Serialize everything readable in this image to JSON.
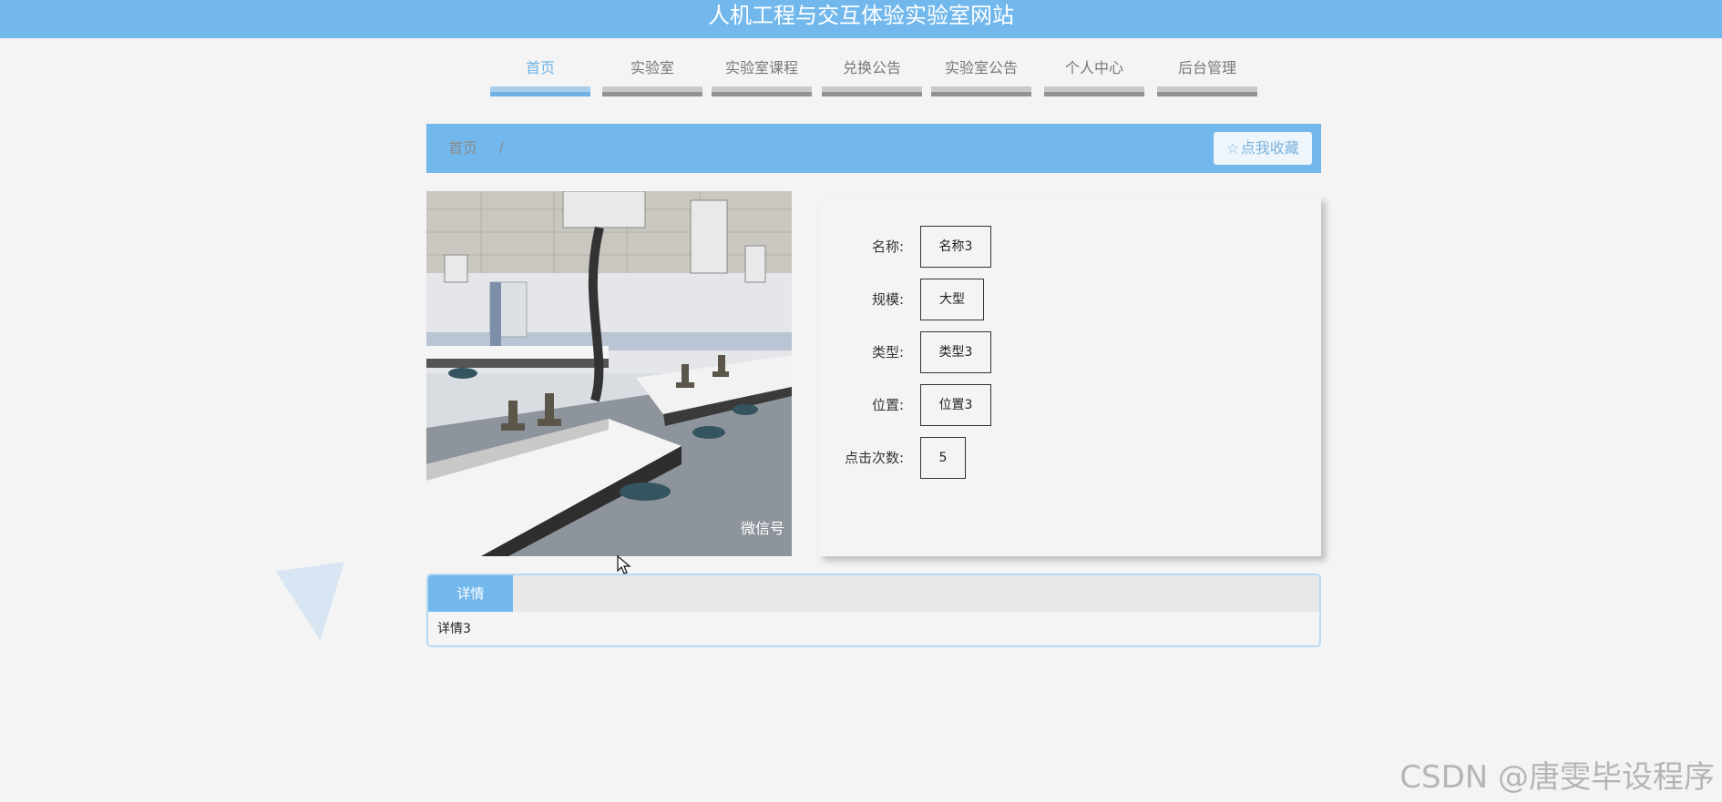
{
  "site": {
    "title": "人机工程与交互体验实验室网站"
  },
  "nav": {
    "items": [
      {
        "label": "首页",
        "active": true
      },
      {
        "label": "实验室",
        "active": false
      },
      {
        "label": "实验室课程",
        "active": false
      },
      {
        "label": "兑换公告",
        "active": false
      },
      {
        "label": "实验室公告",
        "active": false
      },
      {
        "label": "个人中心",
        "active": false
      },
      {
        "label": "后台管理",
        "active": false
      }
    ]
  },
  "breadcrumb": {
    "home": "首页",
    "separator": "/"
  },
  "favorite": {
    "label": "点我收藏",
    "icon": "star-outline-icon"
  },
  "info": {
    "fields": [
      {
        "key": "名称:",
        "value": "名称3"
      },
      {
        "key": "规模:",
        "value": "大型"
      },
      {
        "key": "类型:",
        "value": "类型3"
      },
      {
        "key": "位置:",
        "value": "位置3"
      },
      {
        "key": "点击次数:",
        "value": "5"
      }
    ]
  },
  "detail": {
    "tab_label": "详情",
    "content": "详情3"
  },
  "photo": {
    "watermark": "微信号"
  },
  "watermark": {
    "text": "CSDN @唐雯毕设程序"
  },
  "colors": {
    "primary": "#73b8ec",
    "nav_inactive": "#929292",
    "background": "#f4f4f4"
  }
}
